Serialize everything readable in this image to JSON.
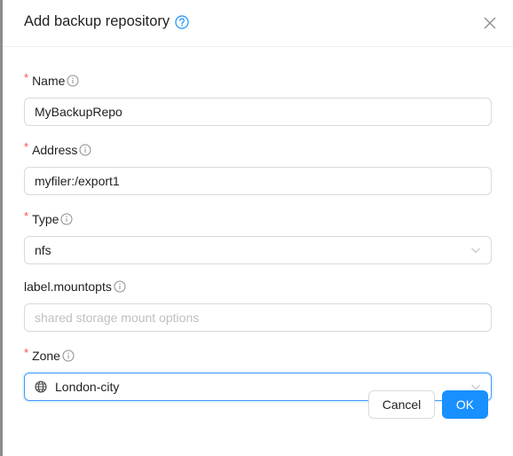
{
  "dialog": {
    "title": "Add backup repository",
    "help_icon": "question-circle-icon",
    "close_icon": "close-icon"
  },
  "form": {
    "fields": [
      {
        "label": "Name",
        "required": true,
        "value": "MyBackupRepo",
        "placeholder": "",
        "type": "text"
      },
      {
        "label": "Address",
        "required": true,
        "value": "myfiler:/export1",
        "placeholder": "",
        "type": "text"
      },
      {
        "label": "Type",
        "required": true,
        "value": "nfs",
        "placeholder": "",
        "type": "select"
      },
      {
        "label": "label.mountopts",
        "required": false,
        "value": "",
        "placeholder": "shared storage mount options",
        "type": "text"
      },
      {
        "label": "Zone",
        "required": true,
        "value": "London-city",
        "placeholder": "",
        "type": "select",
        "icon": "globe-icon"
      }
    ],
    "required_mark": "*"
  },
  "footer": {
    "cancel_label": "Cancel",
    "ok_label": "OK"
  },
  "colors": {
    "primary": "#1890ff",
    "required": "#ff4d4f",
    "help_icon": "#1890ff"
  }
}
